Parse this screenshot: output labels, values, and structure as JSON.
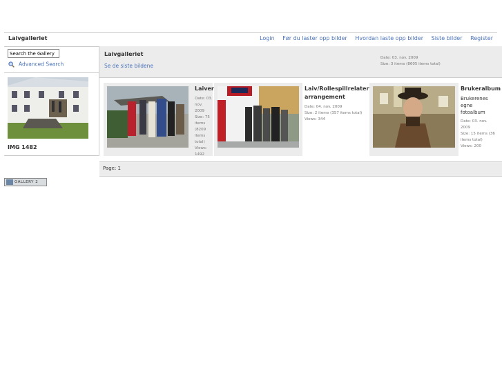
{
  "header": {
    "site_title": "Laivgalleriet",
    "nav": [
      "Login",
      "Før du laster opp bilder",
      "Hvordan laste opp bilder",
      "Siste bilder",
      "Register"
    ]
  },
  "sidebar": {
    "search_placeholder": "Search the Gallery",
    "advanced_search": "Advanced Search",
    "photo_caption": "IMG 1482"
  },
  "album": {
    "title": "Laivgalleriet",
    "link": "Se de siste bildene",
    "date": "Date: 03. nov. 2009",
    "size": "Size: 3 items (8605 items total)"
  },
  "items": [
    {
      "title": "Laiver",
      "meta": [
        "Date: 03.",
        "nov. 2009",
        "Size: 75",
        "items",
        "(8209",
        "items",
        "total)",
        "Views:",
        "1492"
      ]
    },
    {
      "title": "Laiv/Rollespillrelaterte arrangement",
      "meta": [
        "Date: 04. nov. 2009",
        "Size: 2 items (357 items total)",
        "Views: 344"
      ]
    },
    {
      "title": "Brukeralbum",
      "description": "Brukerenes egne fotoalbum",
      "meta": [
        "Date: 03. nov. 2009",
        "Size: 15 items (36",
        "items total)",
        "Views: 200"
      ]
    }
  ],
  "pagination": {
    "label": "Page: 1"
  },
  "footer": {
    "badge": "GALLERY 2"
  },
  "colors": {
    "link": "#4a72b8",
    "band": "#ececec",
    "border": "#cccccc"
  }
}
